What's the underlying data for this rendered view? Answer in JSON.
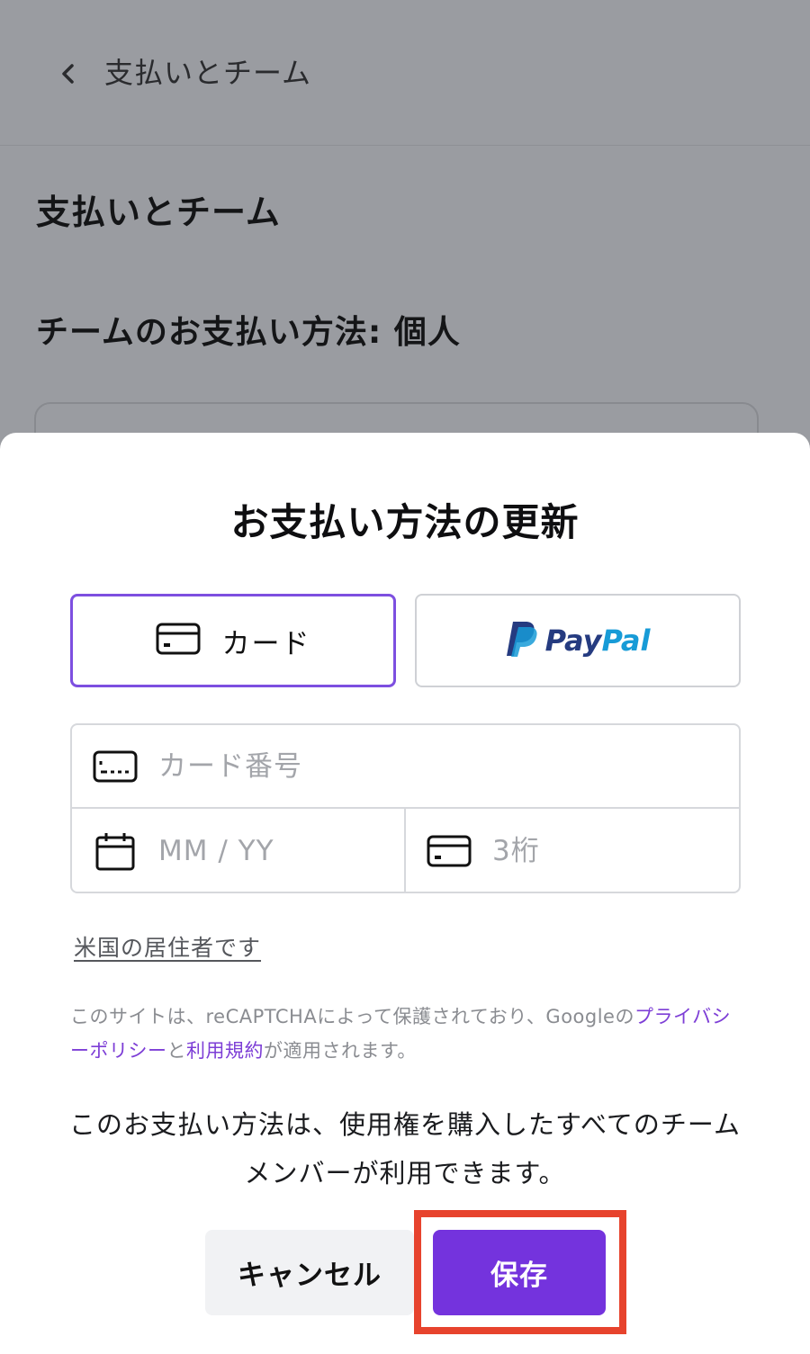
{
  "header": {
    "back_icon": "chevron-left-icon",
    "title": "支払いとチーム"
  },
  "background_page": {
    "heading": "支払いとチーム",
    "subheading": "チームのお支払い方法: 個人"
  },
  "modal": {
    "title": "お支払い方法の更新",
    "methods": {
      "card": {
        "label": "カード",
        "icon": "credit-card-icon",
        "selected": true
      },
      "paypal": {
        "label_pay": "Pay",
        "label_pal": "Pal",
        "icon": "paypal-logo"
      }
    },
    "fields": {
      "card_number": {
        "placeholder": "カード番号",
        "icon": "card-number-icon"
      },
      "expiry": {
        "placeholder": "MM / YY",
        "icon": "calendar-icon"
      },
      "cvc": {
        "placeholder": "3桁",
        "icon": "card-back-icon"
      }
    },
    "us_resident_link": "米国の居住者です",
    "recaptcha": {
      "prefix": "このサイトは、reCAPTCHAによって保護されており、Googleの",
      "privacy_link": "プライバシーポリシー",
      "and": "と",
      "terms_link": "利用規約",
      "suffix": "が適用されます。"
    },
    "team_note": "このお支払い方法は、使用権を購入したすべてのチームメンバーが利用できます。",
    "cancel_label": "キャンセル",
    "save_label": "保存"
  },
  "colors": {
    "accent": "#7433dd",
    "selected_border": "#7d4fe0",
    "link": "#7d3ed6",
    "highlight": "#e7432d",
    "paypal_dark": "#253b80",
    "paypal_light": "#179bd7"
  }
}
